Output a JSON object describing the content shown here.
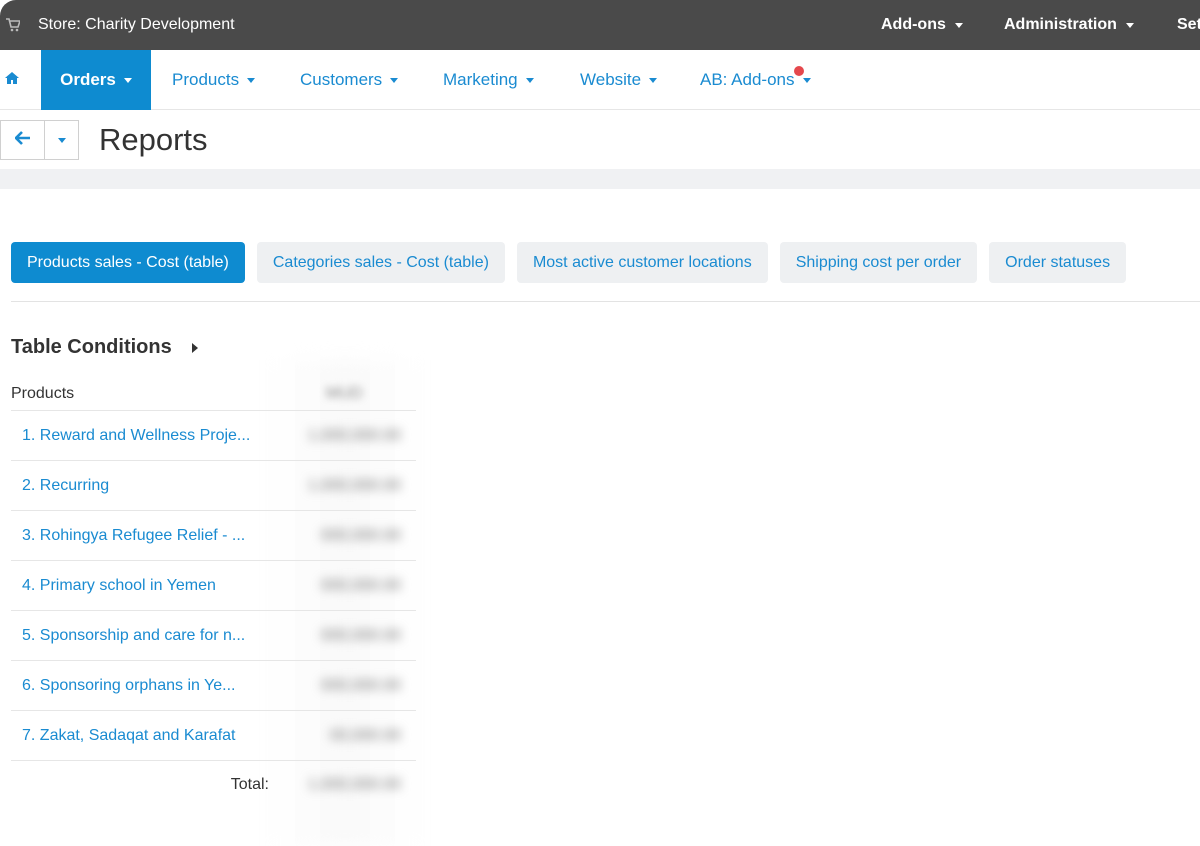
{
  "topbar": {
    "store_label": "Store: Charity Development",
    "menus": [
      "Add-ons",
      "Administration",
      "Set"
    ]
  },
  "nav": {
    "items": [
      "Orders",
      "Products",
      "Customers",
      "Marketing",
      "Website",
      "AB: Add-ons"
    ],
    "active": "Orders"
  },
  "page": {
    "title": "Reports"
  },
  "report_tabs": [
    "Products sales - Cost (table)",
    "Categories sales - Cost (table)",
    "Most active customer locations",
    "Shipping cost per order",
    "Order statuses"
  ],
  "table": {
    "conditions_label": "Table Conditions",
    "header_products": "Products",
    "header_amount": "MUD",
    "rows": [
      {
        "name": "1. Reward and Wellness Proje...",
        "amount": "1,000,000.00"
      },
      {
        "name": "2. Recurring",
        "amount": "1,000,000.00"
      },
      {
        "name": "3. Rohingya Refugee Relief - ...",
        "amount": "000,000.00"
      },
      {
        "name": "4. Primary school in Yemen",
        "amount": "000,000.00"
      },
      {
        "name": "5. Sponsorship and care for n...",
        "amount": "000,000.00"
      },
      {
        "name": "6. Sponsoring orphans in Ye...",
        "amount": "000,000.00"
      },
      {
        "name": "7. Zakat, Sadaqat and Karafat",
        "amount": "00,000.00"
      }
    ],
    "total_label": "Total:",
    "total_amount": "1,000,000.00"
  }
}
